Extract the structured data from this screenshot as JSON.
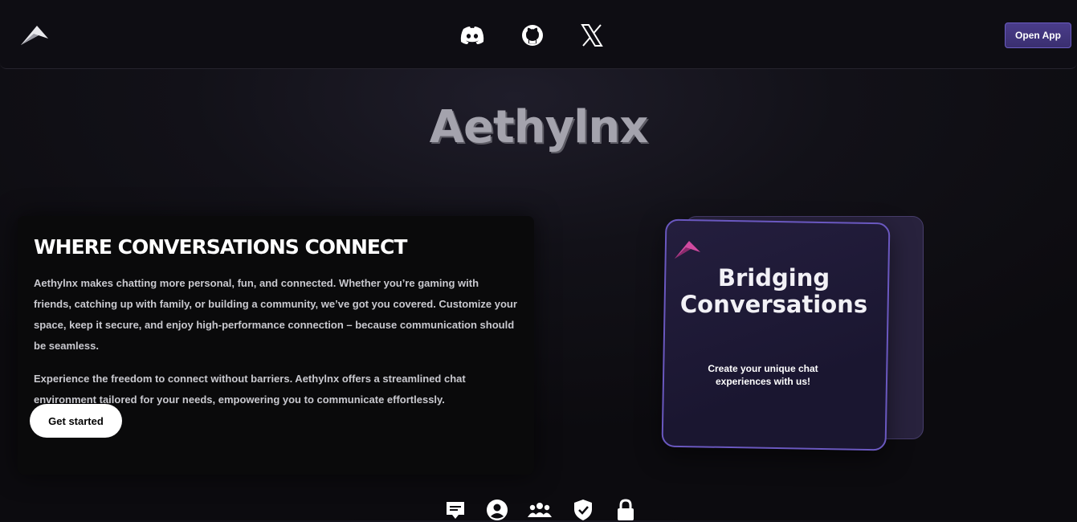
{
  "header": {
    "social": [
      {
        "name": "discord-icon"
      },
      {
        "name": "github-icon"
      },
      {
        "name": "x-icon"
      }
    ],
    "open_app_label": "Open App"
  },
  "hero": {
    "brand": "Aethylnx"
  },
  "intro": {
    "heading": "WHERE CONVERSATIONS CONNECT",
    "paragraph1": "Aethylnx makes chatting more personal, fun, and connected. Whether you’re gaming with friends, catching up with family, or building a community, we’ve got you covered. Customize your space, keep it secure, and enjoy high-performance connection – because communication should be seamless.",
    "paragraph2": "Experience the freedom to connect without barriers. Aethylnx offers a streamlined chat environment tailored for your needs, empowering you to communicate effortlessly.",
    "cta_label": "Get started"
  },
  "card": {
    "title_line1": "Bridging",
    "title_line2": "Conversations",
    "subtitle": "Create your unique chat experiences with us!"
  },
  "features": [
    "chat-icon",
    "user-icon",
    "group-icon",
    "shield-check-icon",
    "lock-icon"
  ],
  "colors": {
    "accent": "#4a3c8a",
    "card_border": "#6a58c0",
    "logo_pink": "#c2378e"
  }
}
